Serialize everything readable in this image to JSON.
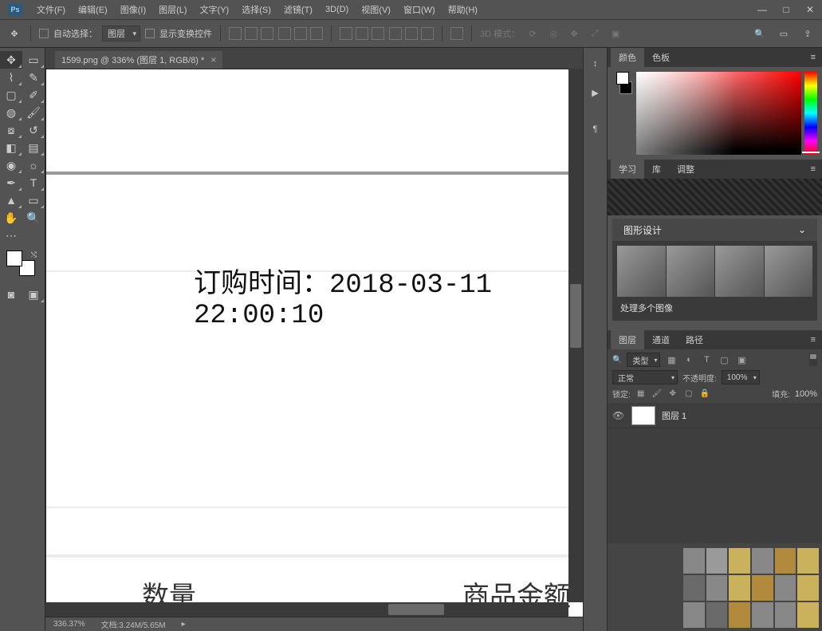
{
  "menubar": {
    "items": [
      "文件(F)",
      "编辑(E)",
      "图像(I)",
      "图层(L)",
      "文字(Y)",
      "选择(S)",
      "滤镜(T)",
      "3D(D)",
      "视图(V)",
      "窗口(W)",
      "帮助(H)"
    ]
  },
  "options": {
    "auto_select_label": "自动选择：",
    "auto_select_value": "图层",
    "show_transform_label": "显示变换控件",
    "mode_3d_label": "3D 模式："
  },
  "doc_tab": {
    "title": "1599.png @ 336% (图层 1, RGB/8) *"
  },
  "canvas": {
    "main_text": "订购时间：2018-03-11 22:00:10",
    "bottom_left": "数量",
    "bottom_right": "商品金额"
  },
  "status": {
    "zoom": "336.37%",
    "doc_size": "文档:3.24M/5.65M"
  },
  "panels": {
    "color_tabs": [
      "颜色",
      "色板"
    ],
    "learn_tabs": [
      "学习",
      "库",
      "调整"
    ],
    "learn_card_title": "图形设计",
    "learn_card_caption": "处理多个图像",
    "layer_tabs": [
      "图层",
      "通道",
      "路径"
    ],
    "layers": {
      "filter_kind": "类型",
      "blend_mode": "正常",
      "opacity_label": "不透明度:",
      "opacity_value": "100%",
      "lock_label": "锁定:",
      "fill_label": "填充:",
      "fill_value": "100%",
      "layer1_name": "图层 1"
    }
  }
}
